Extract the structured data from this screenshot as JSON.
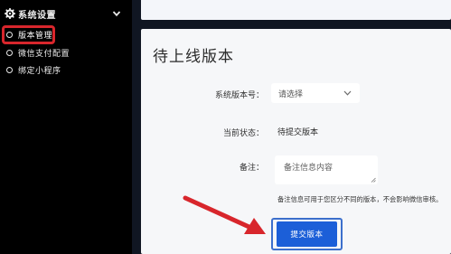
{
  "sidebar": {
    "group_label": "系统设置",
    "items": [
      {
        "label": "版本管理",
        "active": true
      },
      {
        "label": "微信支付配置",
        "active": false
      },
      {
        "label": "绑定小程序",
        "active": false
      }
    ]
  },
  "main": {
    "title": "待上线版本",
    "form": {
      "version_label": "系统版本号：",
      "version_value": "请选择",
      "status_label": "当前状态：",
      "status_value": "待提交版本",
      "remark_label": "备注：",
      "remark_placeholder": "备注信息内容",
      "help_text": "备注信息可用于您区分不同的版本，不会影响微信审核。",
      "submit_label": "提交版本"
    }
  },
  "colors": {
    "highlight": "#d8262c",
    "primary": "#1c5fd8",
    "annotation_arrow": "#d8262c"
  },
  "icons": {
    "group": "gear-icon",
    "group_toggle": "chevron-down-icon",
    "select_arrow": "chevron-down-icon"
  }
}
